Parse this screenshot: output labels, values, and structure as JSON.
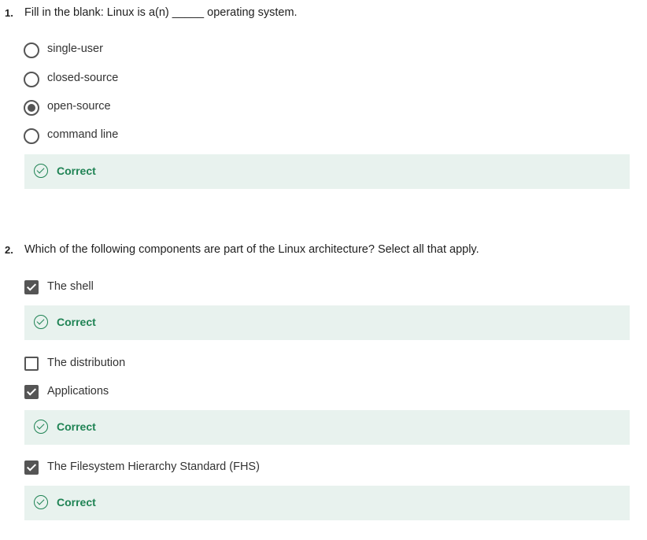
{
  "colors": {
    "correct_text": "#1f8354",
    "correct_bg": "#e8f2ee",
    "control": "#555555"
  },
  "questions": [
    {
      "number": "1.",
      "text": "Fill in the blank: Linux is a(n) _____ operating system.",
      "type": "single-choice",
      "options": [
        {
          "label": "single-user",
          "selected": false
        },
        {
          "label": "closed-source",
          "selected": false
        },
        {
          "label": "open-source",
          "selected": true
        },
        {
          "label": "command line",
          "selected": false
        }
      ],
      "feedback": {
        "icon": "check-circle-icon",
        "text": "Correct"
      }
    },
    {
      "number": "2.",
      "text": "Which of the following components are part of the Linux architecture? Select all that apply.",
      "type": "multiple-choice",
      "options": [
        {
          "label": "The shell",
          "checked": true,
          "feedback": "Correct"
        },
        {
          "label": "The distribution",
          "checked": false
        },
        {
          "label": "Applications",
          "checked": true,
          "feedback": "Correct"
        },
        {
          "label": "The Filesystem Hierarchy Standard (FHS)",
          "checked": true,
          "feedback": "Correct"
        }
      ]
    }
  ]
}
